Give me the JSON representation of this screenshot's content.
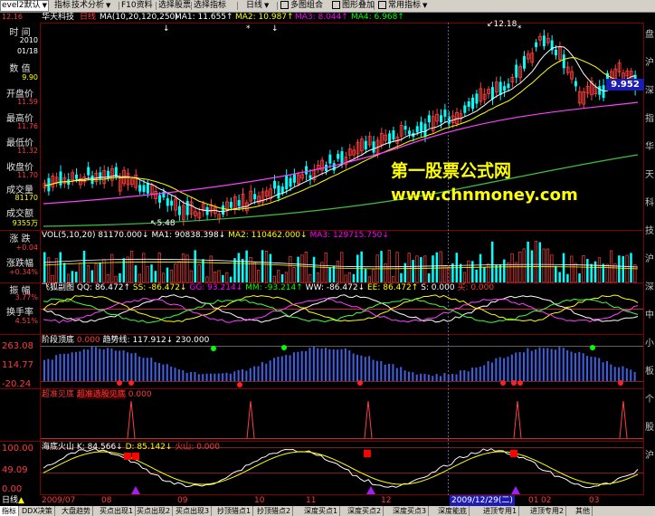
{
  "toolbar": {
    "level_select": "evel2默认",
    "items": [
      "指标",
      "技术分析",
      "F10资料",
      "选择股票",
      "选择指标",
      "日线",
      "多图组合",
      "图形叠加",
      "常用指标"
    ]
  },
  "info_line": {
    "stock_name": "华天科技",
    "period": "日线",
    "ma_label": "MA(10,20,120,250)",
    "ma1": "MA1: 11.655↑",
    "ma2": "MA2: 10.987↑",
    "ma3": "MA3: 8.044↑",
    "ma4": "MA4: 6.968↑"
  },
  "left_panel": {
    "time_label": "时  间",
    "year": "2010",
    "date": "01/18",
    "value_label": "数  值",
    "value": "9.90",
    "open_label": "开盘价",
    "open": "11.59",
    "high_label": "最高价",
    "high": "11.76",
    "low_label": "最低价",
    "low": "11.32",
    "close_label": "收盘价",
    "close": "11.70",
    "volume_label": "成交量",
    "volume": "81170",
    "amount_label": "成交额",
    "amount": "9355万",
    "change_label": "涨  跌",
    "change": "+0.04",
    "pct_label": "涨跌幅",
    "pct": "+0.34%",
    "amp_label": "振  幅",
    "amp": "3.77%",
    "turnover_label": "换手率",
    "turnover": "4.51%"
  },
  "main_chart": {
    "left_scale_top": "12.16",
    "high_marker": "12.18",
    "low_marker": "5.48",
    "price_tag": "9.952"
  },
  "watermark": {
    "line1": "第一股票公式网",
    "line2": "www.chnmoney.com"
  },
  "vol_panel": {
    "title": "VOL(5,10,20)",
    "v": "81170.000↓",
    "ma1": "MA1: 90838.398↓",
    "ma2": "MA2: 110462.000↓",
    "ma3": "MA3: 129715.750↓"
  },
  "fox_panel": {
    "title": "飞狐副图",
    "qq": "QQ: 86.472↑",
    "ss": "SS: -86.472↓",
    "gg": "GG: 93.214↓",
    "mm": "MM: -93.214↑",
    "ww": "WW: -86.472↓",
    "ee": "EE: 86.472↑",
    "s": "S: 0.000",
    "buy": "买: 0.000"
  },
  "stage_panel": {
    "title": "阶段顶底",
    "v1": "0.000",
    "trend_label": "趋势线:",
    "trend": "117.912↓",
    "v3": "230.000",
    "y_top": "263.08",
    "y_mid": "114.77",
    "y_bot": "-20.24"
  },
  "super_panel": {
    "title": "超准见底",
    "sub": "超准选股见底",
    "v": "0.000"
  },
  "kd_panel": {
    "title": "海底火山",
    "k": "K: 84.566↓",
    "d": "D: 85.142↓",
    "fire": "火山: 0.000",
    "y_top": "100.00",
    "y_mid": "49.09",
    "y_bot": "0.00"
  },
  "date_bar": {
    "period": "日线",
    "labels": [
      "2009/07",
      "08",
      "09",
      "10",
      "11",
      "12",
      "01",
      "02",
      "03"
    ],
    "cursor_date": "2009/12/29(二)"
  },
  "bottom_tabs": [
    "指标",
    "DDX决策",
    "大盘趋势",
    "买点出现1",
    "买点出现2",
    "买点出现3",
    "抄顶猎点1",
    "抄顶猎点2",
    "深度买点1",
    "深度买点2",
    "深度买点3",
    "深度能底",
    "进顶专用1",
    "进顶专用2",
    "其他"
  ],
  "right_strip": [
    "盘",
    "沪",
    "深",
    "指",
    "华",
    "天",
    "科",
    "技",
    "沪",
    "深",
    "中",
    "小",
    "板",
    "个",
    "股",
    "沪"
  ]
}
